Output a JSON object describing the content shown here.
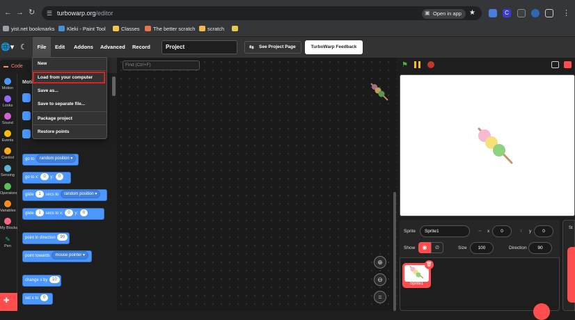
{
  "browser": {
    "url_host": "turbowarp.org",
    "url_path": "/editor",
    "open_in_app": "Open in app",
    "bookmarks": [
      {
        "label": "yist.net bookmarks",
        "color": "#9aa0a6"
      },
      {
        "label": "Kleki - Paint Tool",
        "color": "#4a90d9"
      },
      {
        "label": "Classes",
        "color": "#f2c744"
      },
      {
        "label": "The better scratch",
        "color": "#e8744a"
      },
      {
        "label": "scratch",
        "color": "#f2b84b"
      }
    ],
    "extensions": [
      {
        "letter": "",
        "color": "#4a7de0"
      },
      {
        "letter": "C",
        "color": "#3b3bd6"
      },
      {
        "letter": "",
        "color": "#3c4043"
      },
      {
        "letter": "",
        "color": "#2a6ab5"
      }
    ]
  },
  "menubar": {
    "file": "File",
    "edit": "Edit",
    "addons": "Addons",
    "advanced": "Advanced",
    "record": "Record",
    "project_title": "Project",
    "see_project_page": "See Project Page",
    "feedback": "TurboWarp Feedback"
  },
  "file_menu": {
    "items": [
      "New",
      "Load from your computer",
      "Save as...",
      "Save to separate file...",
      "Package project",
      "Restore points"
    ],
    "highlighted": "Load from your computer"
  },
  "tabs": {
    "code": "Code"
  },
  "categories": [
    {
      "label": "Motion",
      "color": "#4c97ff"
    },
    {
      "label": "Looks",
      "color": "#9966ff"
    },
    {
      "label": "Sound",
      "color": "#cf63cf"
    },
    {
      "label": "Events",
      "color": "#ffbf00"
    },
    {
      "label": "Control",
      "color": "#ffab19"
    },
    {
      "label": "Sensing",
      "color": "#5cb1d6"
    },
    {
      "label": "Operators",
      "color": "#59c059"
    },
    {
      "label": "Variables",
      "color": "#ff8c1a"
    },
    {
      "label": "My Blocks",
      "color": "#ff6680"
    },
    {
      "label": "Pen",
      "color": "#0fbd8c"
    }
  ],
  "palette": {
    "heading": "Motion",
    "go_to": "go to",
    "random_position": "random position",
    "go_to_x": "go to x:",
    "x0": "0",
    "y_label": "y:",
    "y0": "0",
    "glide": "glide",
    "glide_secs": "1",
    "secs_to": "secs to",
    "glide2_secs_to_x": "secs to x:",
    "point_in_direction": "point in direction",
    "direction_val": "90",
    "point_towards": "point towards",
    "mouse_pointer": "mouse pointer",
    "change_x_by": "change x by",
    "change_x_val": "10",
    "set_x_to": "set x to",
    "set_x_val": "0"
  },
  "workspace": {
    "find_placeholder": "Find (Ctrl+F)"
  },
  "sprite_info": {
    "sprite_label": "Sprite",
    "sprite_name": "Sprite1",
    "x_label": "x",
    "x_value": "0",
    "y_label": "y",
    "y_value": "0",
    "show_label": "Show",
    "size_label": "Size",
    "size_value": "100",
    "direction_label": "Direction",
    "direction_value": "90",
    "tile_name": "Sprite1",
    "stage_label": "St"
  },
  "colors": {
    "accent_red": "#ff4c4c",
    "motion_blue": "#4c97ff"
  }
}
